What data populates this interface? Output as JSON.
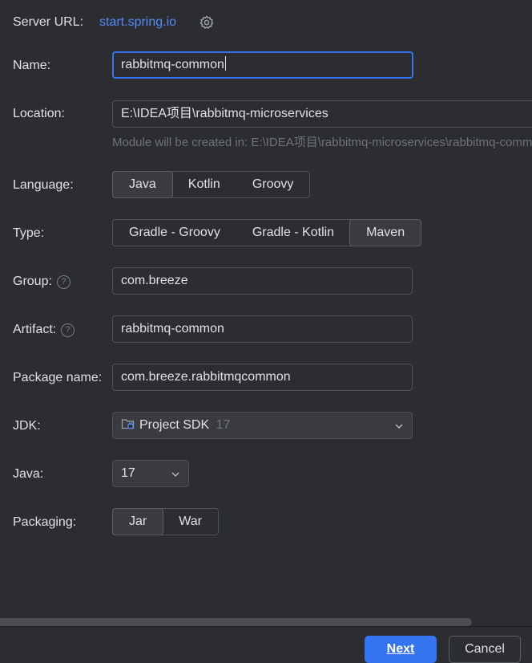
{
  "server": {
    "label": "Server URL:",
    "url": "start.spring.io",
    "settings_icon": "gear-icon"
  },
  "name": {
    "label": "Name:",
    "value": "rabbitmq-common"
  },
  "location": {
    "label": "Location:",
    "value": "E:\\IDEA项目\\rabbitmq-microservices",
    "hint": "Module will be created in: E:\\IDEA项目\\rabbitmq-microservices\\rabbitmq-common"
  },
  "language": {
    "label": "Language:",
    "options": [
      "Java",
      "Kotlin",
      "Groovy"
    ],
    "selected": "Java"
  },
  "type": {
    "label": "Type:",
    "options": [
      "Gradle - Groovy",
      "Gradle - Kotlin",
      "Maven"
    ],
    "selected": "Maven"
  },
  "group": {
    "label": "Group:",
    "value": "com.breeze"
  },
  "artifact": {
    "label": "Artifact:",
    "value": "rabbitmq-common"
  },
  "package_name": {
    "label": "Package name:",
    "value": "com.breeze.rabbitmqcommon"
  },
  "jdk": {
    "label": "JDK:",
    "value": "Project SDK",
    "version": "17",
    "icon": "folder-icon"
  },
  "java": {
    "label": "Java:",
    "value": "17"
  },
  "packaging": {
    "label": "Packaging:",
    "options": [
      "Jar",
      "War"
    ],
    "selected": "Jar"
  },
  "buttons": {
    "next": "Next",
    "cancel": "Cancel"
  },
  "colors": {
    "accent": "#3574f0",
    "link": "#548af7",
    "background": "#2b2d30"
  }
}
